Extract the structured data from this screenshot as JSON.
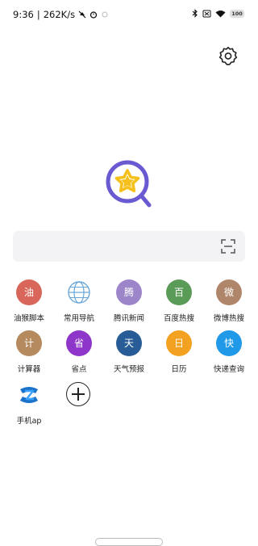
{
  "status": {
    "time": "9:36",
    "speed": "262K/s",
    "battery": "100"
  },
  "search": {
    "placeholder": ""
  },
  "shortcuts": [
    {
      "label": "油猴脚本",
      "glyph": "油",
      "color": "#d9665b"
    },
    {
      "label": "常用导航",
      "glyph": "",
      "color": "#6aa7d8",
      "icon": "globe-icon"
    },
    {
      "label": "腾讯新闻",
      "glyph": "腾",
      "color": "#9c86c9"
    },
    {
      "label": "百度热搜",
      "glyph": "百",
      "color": "#5b9b58"
    },
    {
      "label": "微博热搜",
      "glyph": "微",
      "color": "#b0866a"
    },
    {
      "label": "计算器",
      "glyph": "计",
      "color": "#b48a5e"
    },
    {
      "label": "省点",
      "glyph": "省",
      "color": "#8e36c9"
    },
    {
      "label": "天气预报",
      "glyph": "天",
      "color": "#275c96"
    },
    {
      "label": "日历",
      "glyph": "日",
      "color": "#f2a220"
    },
    {
      "label": "快递查询",
      "glyph": "快",
      "color": "#1f99e8"
    },
    {
      "label": "手机ap",
      "glyph": "",
      "color": "#1a73c9",
      "icon": "app-logo-icon"
    }
  ],
  "colors": {
    "logo_ring": "#6a5ad2",
    "logo_star": "#f5c01b"
  }
}
